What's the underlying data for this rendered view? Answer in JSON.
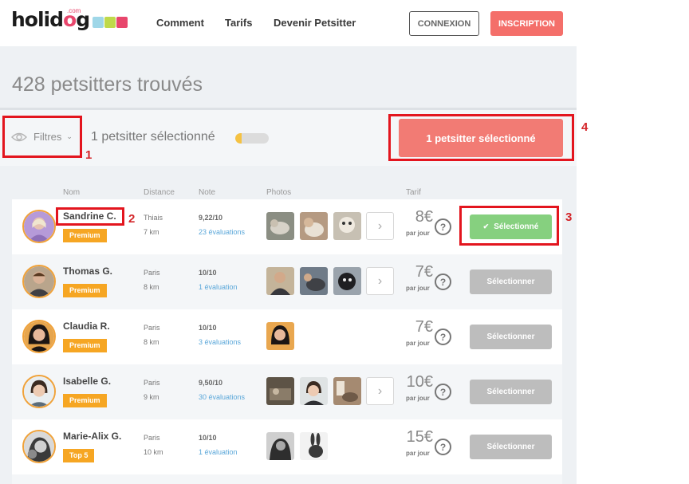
{
  "header": {
    "logo_text": "holidog",
    "logo_com": ".com",
    "nav": [
      "Comment",
      "Tarifs",
      "Devenir Petsitter"
    ],
    "login_label": "CONNEXION",
    "signup_label": "INSCRIPTION",
    "accent_color": "#f46f6a"
  },
  "results_title": "428 petsitters trouvés",
  "toolbar": {
    "filters_label": "Filtres",
    "selected_text": "1 petsitter sélectionné",
    "selection_progress": 0.2,
    "cta_label": "1 petsitter sélectionné"
  },
  "columns": {
    "name": "Nom",
    "distance": "Distance",
    "rating": "Note",
    "photos": "Photos",
    "price": "Tarif"
  },
  "sitters": [
    {
      "name": "Sandrine C.",
      "badge": "Premium",
      "city": "Thiais",
      "distance": "7 km",
      "rating": "9,22/10",
      "reviews": "23 évaluations",
      "price": "8€",
      "per": "par jour",
      "button": "Sélectionné",
      "selected": true
    },
    {
      "name": "Thomas G.",
      "badge": "Premium",
      "city": "Paris",
      "distance": "8 km",
      "rating": "10/10",
      "reviews": "1 évaluation",
      "price": "7€",
      "per": "par jour",
      "button": "Sélectionner",
      "selected": false
    },
    {
      "name": "Claudia R.",
      "badge": "Premium",
      "city": "Paris",
      "distance": "8 km",
      "rating": "10/10",
      "reviews": "3 évaluations",
      "price": "7€",
      "per": "par jour",
      "button": "Sélectionner",
      "selected": false
    },
    {
      "name": "Isabelle G.",
      "badge": "Premium",
      "city": "Paris",
      "distance": "9 km",
      "rating": "9,50/10",
      "reviews": "30 évaluations",
      "price": "10€",
      "per": "par jour",
      "button": "Sélectionner",
      "selected": false
    },
    {
      "name": "Marie-Alix G.",
      "badge": "Top 5",
      "city": "Paris",
      "distance": "10 km",
      "rating": "10/10",
      "reviews": "1 évaluation",
      "price": "15€",
      "per": "par jour",
      "button": "Sélectionner",
      "selected": false
    }
  ],
  "icons": {
    "eye": "eye-icon",
    "chevron": "chevron-down-icon",
    "next": "chevron-right-icon",
    "help": "question-icon",
    "check": "check-icon",
    "help_glyph": "?",
    "next_glyph": "›",
    "check_glyph": "✔"
  },
  "annotations": [
    "1",
    "2",
    "3",
    "4"
  ],
  "status_colors": {
    "selected": "#86d07f",
    "unselected": "#bdbdbd",
    "badge": "#f6a623"
  }
}
